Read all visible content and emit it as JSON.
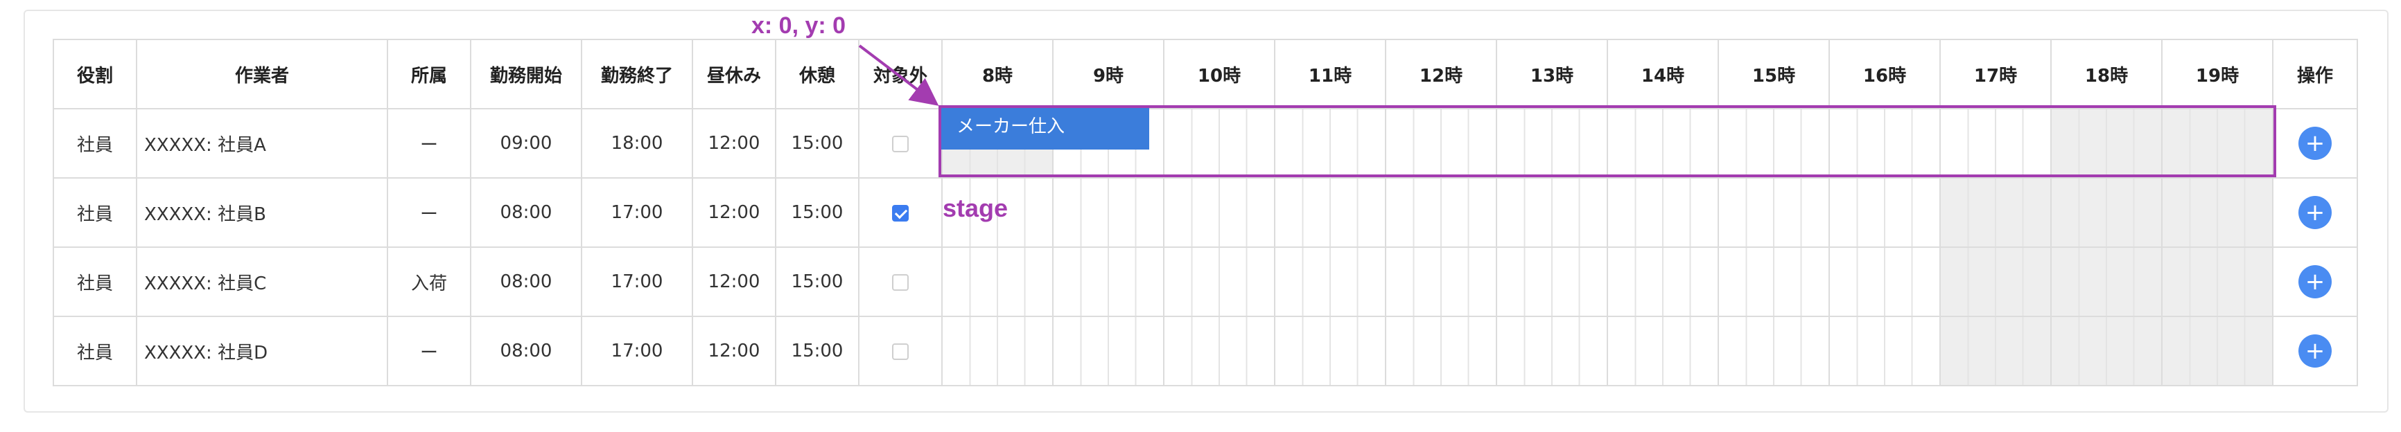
{
  "columns": {
    "role": "役割",
    "worker": "作業者",
    "dept": "所属",
    "start": "勤務開始",
    "end": "勤務終了",
    "lunch": "昼休み",
    "break": "休憩",
    "exclude": "対象外",
    "hours": [
      "8時",
      "9時",
      "10時",
      "11時",
      "12時",
      "13時",
      "14時",
      "15時",
      "16時",
      "17時",
      "18時",
      "19時"
    ],
    "action": "操作"
  },
  "rows": [
    {
      "role": "社員",
      "worker": "XXXXX: 社員A",
      "dept": "ー",
      "start": "09:00",
      "end": "18:00",
      "lunch": "12:00",
      "break": "15:00",
      "excluded": false
    },
    {
      "role": "社員",
      "worker": "XXXXX: 社員B",
      "dept": "ー",
      "start": "08:00",
      "end": "17:00",
      "lunch": "12:00",
      "break": "15:00",
      "excluded": true
    },
    {
      "role": "社員",
      "worker": "XXXXX: 社員C",
      "dept": "入荷",
      "start": "08:00",
      "end": "17:00",
      "lunch": "12:00",
      "break": "15:00",
      "excluded": false
    },
    {
      "role": "社員",
      "worker": "XXXXX: 社員D",
      "dept": "ー",
      "start": "08:00",
      "end": "17:00",
      "lunch": "12:00",
      "break": "15:00",
      "excluded": false
    }
  ],
  "task": {
    "label": "メーカー仕入"
  },
  "annotations": {
    "origin_label": "x: 0, y: 0",
    "stage_label": "stage",
    "color": "#a33cb0"
  },
  "add_button_symbol": "+",
  "colors": {
    "accent": "#4a8cf2",
    "task_bar": "#3b7ddb",
    "offhours_shade": "#eeeeee",
    "grid": "#dcdcdc"
  }
}
